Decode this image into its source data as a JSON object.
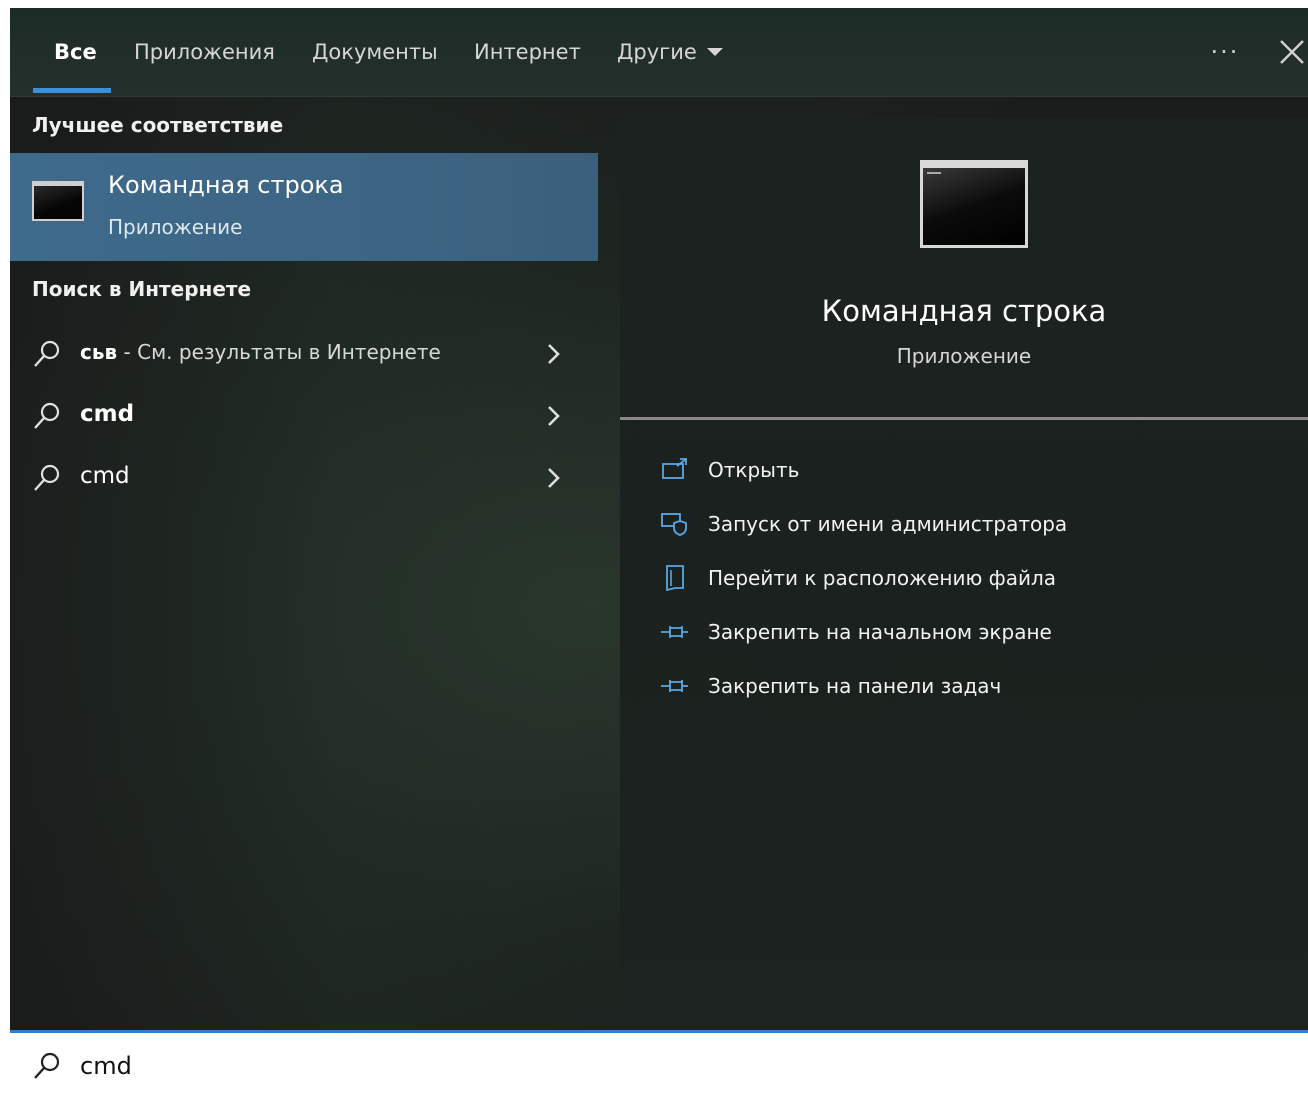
{
  "tabs": [
    {
      "label": "Все",
      "active": true
    },
    {
      "label": "Приложения"
    },
    {
      "label": "Документы"
    },
    {
      "label": "Интернет"
    },
    {
      "label": "Другие"
    }
  ],
  "header": {
    "more_label": "···",
    "close_icon": "close-icon"
  },
  "left": {
    "best_match_title": "Лучшее соответствие",
    "best_match": {
      "title": "Командная строка",
      "subtitle": "Приложение",
      "icon": "cmd-icon"
    },
    "web_title": "Поиск в Интернете",
    "web_results": [
      {
        "bold": "сьв",
        "rest": " - См. результаты в Интернете"
      },
      {
        "bold": "cmd",
        "rest": ""
      },
      {
        "bold": "",
        "rest": "cmd"
      }
    ]
  },
  "preview": {
    "title": "Командная строка",
    "subtitle": "Приложение",
    "actions": [
      {
        "label": "Открыть",
        "icon": "open-icon"
      },
      {
        "label": "Запуск от имени администратора",
        "icon": "shield-icon"
      },
      {
        "label": "Перейти к расположению файла",
        "icon": "folder-location-icon"
      },
      {
        "label": "Закрепить на начальном экране",
        "icon": "pin-icon"
      },
      {
        "label": "Закрепить на панели задач",
        "icon": "pin-icon"
      }
    ]
  },
  "search": {
    "value": "cmd"
  },
  "colors": {
    "accent": "#3c8fd8",
    "selected": "#3e6a8c"
  }
}
